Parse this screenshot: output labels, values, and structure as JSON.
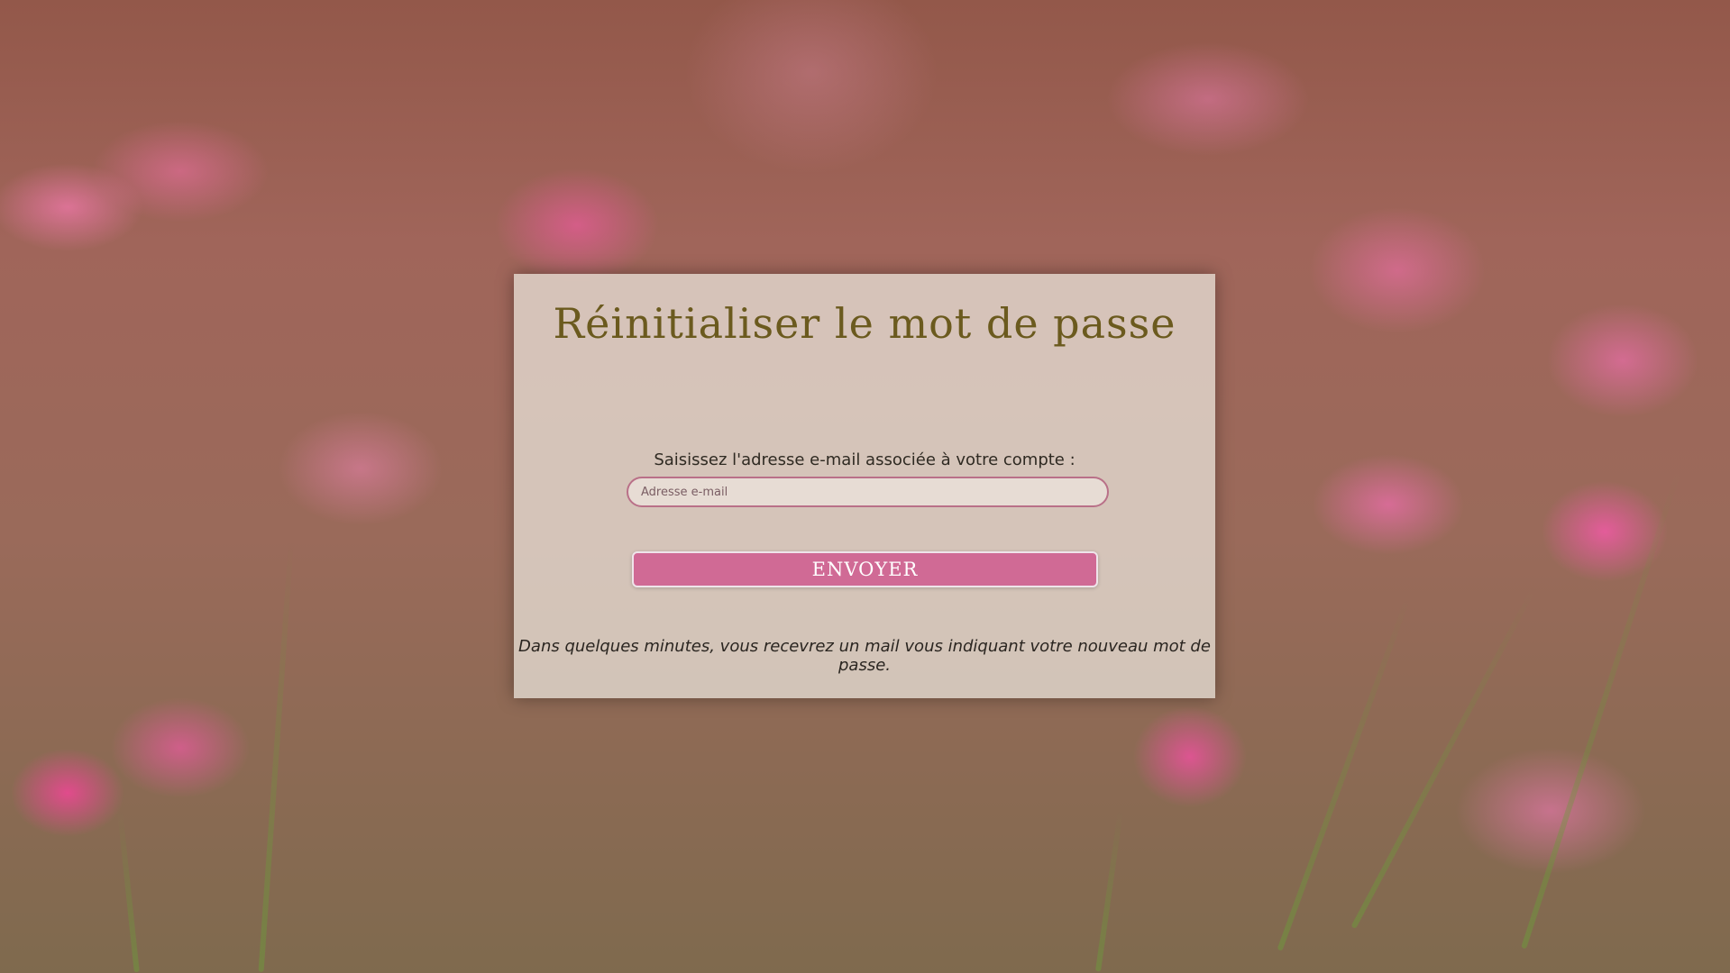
{
  "reset_form": {
    "title": "Réinitialiser le mot de passe",
    "instruction": "Saisissez l'adresse e-mail associée à votre compte :",
    "email_placeholder": "Adresse e-mail",
    "email_value": "",
    "submit_label": "ENVOYER",
    "note": "Dans quelques minutes, vous recevrez un mail vous indiquant votre nouveau mot de passe."
  },
  "colors": {
    "title": "#6b5a1e",
    "button_background": "#d06a95",
    "input_border": "#b97088",
    "card_background": "#ebe8de"
  }
}
